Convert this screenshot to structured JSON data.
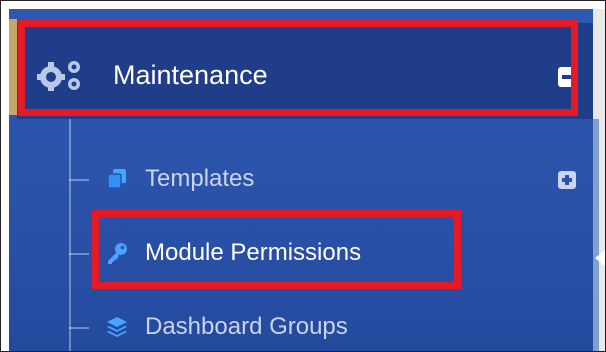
{
  "sidebar": {
    "parent": {
      "label": "Maintenance",
      "icon": "cogs-icon",
      "toggle_icon": "minus-square-icon"
    },
    "children": [
      {
        "label": "Templates",
        "icon": "copy-icon",
        "toggle_icon": "plus-square-icon",
        "color": "#c9d4ea"
      },
      {
        "label": "Module Permissions",
        "icon": "key-icon",
        "color": "#ffffff"
      },
      {
        "label": "Dashboard Groups",
        "icon": "layers-icon",
        "color": "#c9d4ea"
      }
    ]
  },
  "colors": {
    "sidebar_bg": "#2b53aa",
    "active_parent_bg": "#1f3d88",
    "highlight": "#e41b26",
    "icon_accent": "#4aa3ff"
  }
}
